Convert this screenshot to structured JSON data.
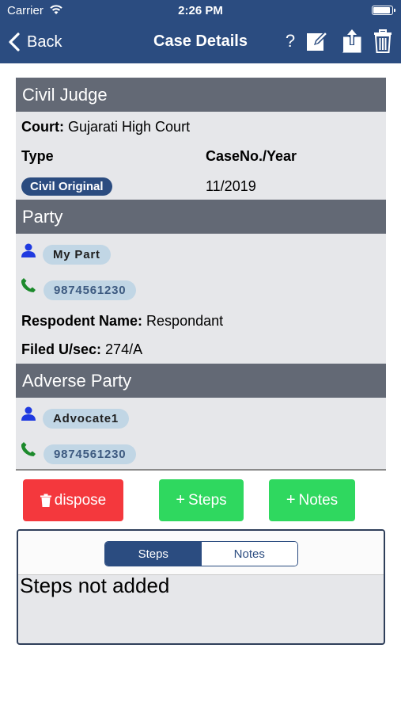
{
  "status": {
    "carrier": "Carrier",
    "time": "2:26 PM",
    "battery_level": 0.95
  },
  "nav": {
    "back_label": "Back",
    "title": "Case Details",
    "help_label": "?"
  },
  "case": {
    "section_title": "Civil Judge",
    "court_label": "Court:",
    "court_value": "Gujarati High Court",
    "type_label": "Type",
    "caseno_label": "CaseNo./Year",
    "type_value": "Civil Original",
    "caseno_value": "11/2019"
  },
  "party": {
    "section_title": "Party",
    "name": "My Part",
    "phone": "9874561230",
    "respondent_label": "Respodent Name:",
    "respondent_value": "Respondant",
    "filed_label": "Filed U/sec:",
    "filed_value": "274/A"
  },
  "adverse": {
    "section_title": "Adverse Party",
    "name": "Advocate1",
    "phone": "9874561230"
  },
  "actions": {
    "dispose": "dispose",
    "steps": "Steps",
    "notes": "Notes",
    "plus": "+"
  },
  "tabs": {
    "steps": "Steps",
    "notes": "Notes",
    "selected": "Steps"
  },
  "empty_message": "Steps not added",
  "colors": {
    "nav": "#2b4c80",
    "section_header": "#636975",
    "danger": "#f4383d",
    "success": "#2fd85f",
    "card": "#e6e7ea",
    "chip": "#c1d6e5"
  },
  "icons": [
    "wifi-icon",
    "battery-icon",
    "back-chevron-icon",
    "help-icon",
    "edit-icon",
    "share-icon",
    "trash-icon",
    "person-icon",
    "phone-icon"
  ]
}
